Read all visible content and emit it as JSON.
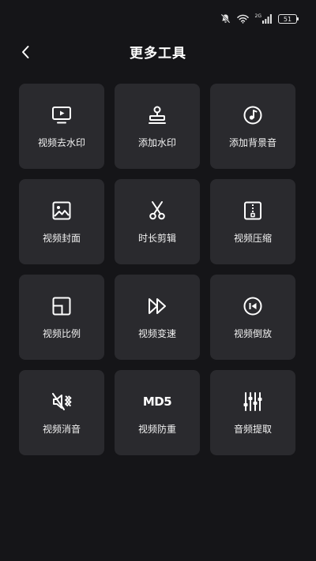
{
  "status_bar": {
    "network_label": "2G",
    "battery": "51"
  },
  "header": {
    "title": "更多工具"
  },
  "tools": [
    {
      "label": "视频去水印",
      "icon": "video-screen-icon"
    },
    {
      "label": "添加水印",
      "icon": "stamp-icon"
    },
    {
      "label": "添加背景音",
      "icon": "music-note-icon"
    },
    {
      "label": "视频封面",
      "icon": "image-icon"
    },
    {
      "label": "时长剪辑",
      "icon": "scissors-icon"
    },
    {
      "label": "视频压缩",
      "icon": "zip-file-icon"
    },
    {
      "label": "视频比例",
      "icon": "aspect-ratio-icon"
    },
    {
      "label": "视频变速",
      "icon": "fast-forward-icon"
    },
    {
      "label": "视频倒放",
      "icon": "rewind-icon"
    },
    {
      "label": "视频消音",
      "icon": "mute-speaker-icon"
    },
    {
      "label": "视频防重",
      "icon": "md5-icon",
      "icon_text": "MD5"
    },
    {
      "label": "音频提取",
      "icon": "equalizer-icon"
    }
  ]
}
